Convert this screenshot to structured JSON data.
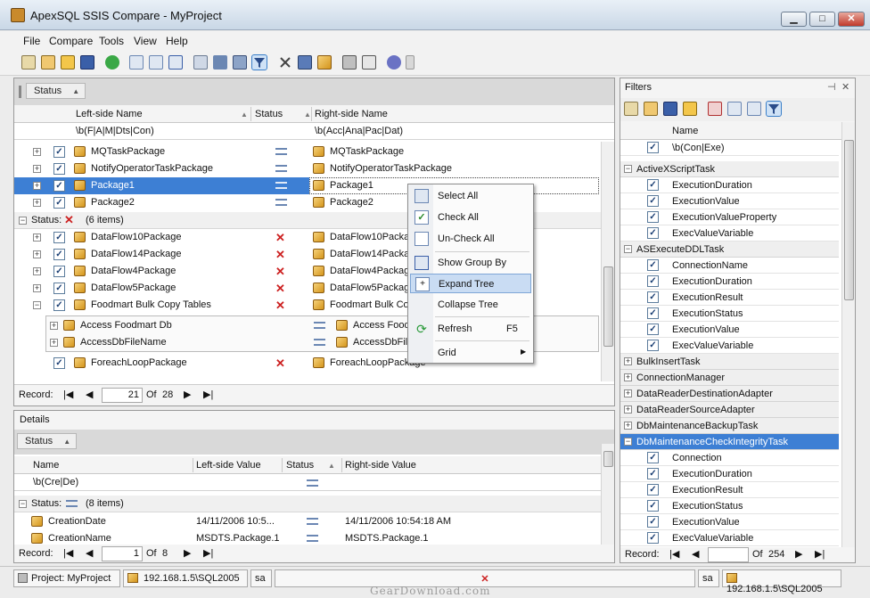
{
  "window": {
    "title": "ApexSQL SSIS Compare - MyProject",
    "min": "▁",
    "max": "□",
    "close": "✕"
  },
  "menu": [
    "File",
    "Compare",
    "Tools",
    "View",
    "Help"
  ],
  "toolbar_icons": [
    "new-project-icon",
    "edit-project-icon",
    "open-icon",
    "save-icon",
    "refresh-icon",
    "copy-left-icon",
    "copy-right-icon",
    "grid-view-icon",
    "columns-icon",
    "align-icon",
    "sync-icon",
    "filter-icon",
    "tools-icon",
    "window-icon",
    "package-icon",
    "print-icon",
    "print-preview-icon",
    "help-icon",
    "overflow-icon"
  ],
  "main": {
    "group_chip": "Status",
    "columns": {
      "left": "Left-side Name",
      "status": "Status",
      "right": "Right-side Name"
    },
    "filters": {
      "left": "\\b(F|A|M|Dts|Con)",
      "right": "\\b(Acc|Ana|Pac|Dat)"
    },
    "rows_equal": [
      {
        "left": "MQTaskPackage",
        "right": "MQTaskPackage"
      },
      {
        "left": "NotifyOperatorTaskPackage",
        "right": "NotifyOperatorTaskPackage"
      },
      {
        "left": "Package1",
        "right": "Package1"
      },
      {
        "left": "Package2",
        "right": "Package2"
      }
    ],
    "group_label": "Status:",
    "group_count": "(6 items)",
    "rows_diff": [
      {
        "left": "DataFlow10Package",
        "right": "DataFlow10Package"
      },
      {
        "left": "DataFlow14Package",
        "right": "DataFlow14Package"
      },
      {
        "left": "DataFlow4Package",
        "right": "DataFlow4Package"
      },
      {
        "left": "DataFlow5Package",
        "right": "DataFlow5Package"
      },
      {
        "left": "Foodmart Bulk Copy Tables",
        "right": "Foodmart Bulk Co"
      }
    ],
    "child_rows": [
      {
        "left": "Access Foodmart Db",
        "right": "Access Food"
      },
      {
        "left": "AccessDbFileName",
        "right": "AccessDbFil"
      }
    ],
    "last_row": {
      "left": "ForeachLoopPackage",
      "right": "ForeachLoopPackage"
    },
    "record": {
      "label": "Record:",
      "current": "21",
      "of": "Of",
      "total": "28"
    }
  },
  "context_menu": {
    "items": [
      {
        "label": "Select All"
      },
      {
        "label": "Check All"
      },
      {
        "label": "Un-Check All"
      },
      {
        "label": "Show Group By"
      },
      {
        "label": "Expand Tree"
      },
      {
        "label": "Collapse Tree"
      },
      {
        "label": "Refresh",
        "shortcut": "F5"
      },
      {
        "label": "Grid",
        "arrow": "▶"
      }
    ]
  },
  "details": {
    "title": "Details",
    "group_chip": "Status",
    "columns": {
      "name": "Name",
      "left": "Left-side Value",
      "status": "Status",
      "right": "Right-side Value"
    },
    "filter": "\\b(Cre|De)",
    "group_label": "Status:",
    "group_count": "(8 items)",
    "rows": [
      {
        "name": "CreationDate",
        "left": "14/11/2006 10:5...",
        "right": "14/11/2006 10:54:18 AM"
      },
      {
        "name": "CreationName",
        "left": "MSDTS.Package.1",
        "right": "MSDTS.Package.1"
      }
    ],
    "record": {
      "label": "Record:",
      "current": "1",
      "of": "Of",
      "total": "8"
    }
  },
  "filters": {
    "title": "Filters",
    "column": "Name",
    "top_filter": "\\b(Con|Exe)",
    "groups": [
      {
        "name": "ActiveXScriptTask",
        "items": [
          "ExecutionDuration",
          "ExecutionValue",
          "ExecutionValueProperty",
          "ExecValueVariable"
        ]
      },
      {
        "name": "ASExecuteDDLTask",
        "items": [
          "ConnectionName",
          "ExecutionDuration",
          "ExecutionResult",
          "ExecutionStatus",
          "ExecutionValue",
          "ExecValueVariable"
        ]
      }
    ],
    "collapsed": [
      "BulkInsertTask",
      "ConnectionManager",
      "DataReaderDestinationAdapter",
      "DataReaderSourceAdapter",
      "DbMaintenanceBackupTask"
    ],
    "selected_group": {
      "name": "DbMaintenanceCheckIntegrityTask",
      "items": [
        "Connection",
        "ExecutionDuration",
        "ExecutionResult",
        "ExecutionStatus",
        "ExecutionValue",
        "ExecValueVariable"
      ]
    },
    "record": {
      "label": "Record:",
      "of": "Of",
      "total": "254"
    }
  },
  "statusbar": {
    "project": "Project: MyProject",
    "left_server": "192.168.1.5\\SQL2005",
    "left_user": "sa",
    "right_user": "sa",
    "right_server": "192.168.1.5\\SQL2005"
  },
  "watermark": "GearDownload.com",
  "colors": {
    "selection": "#3d7fd4",
    "highlight_menu": "#c9dcf3",
    "diff_mark": "#cc2020",
    "equal_mark": "#6b87b3"
  }
}
